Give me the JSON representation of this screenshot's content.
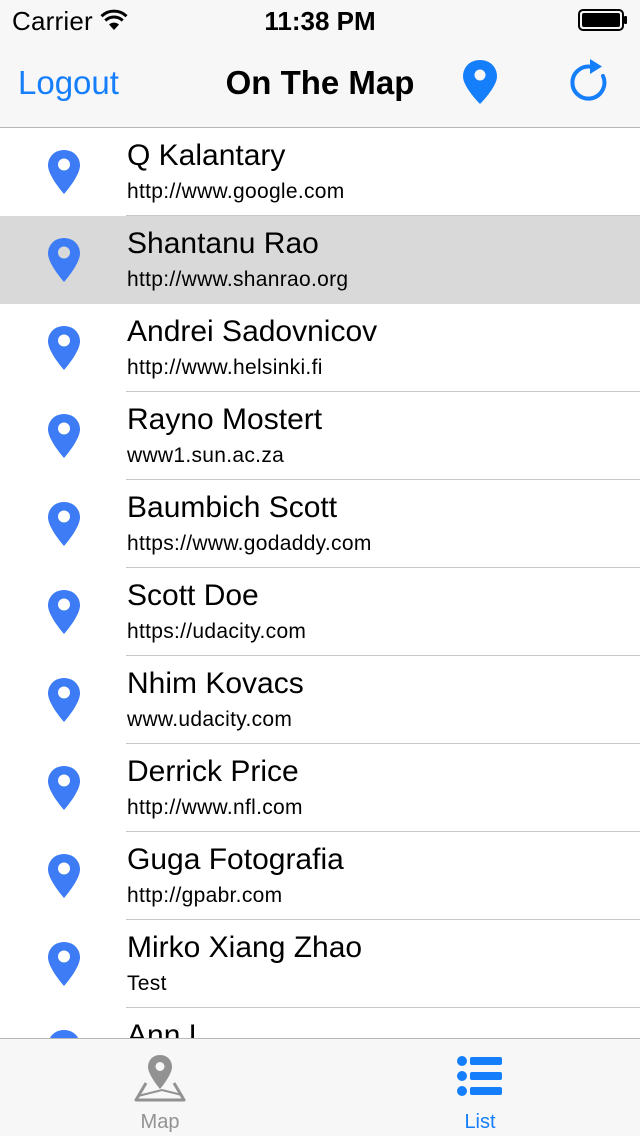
{
  "status_bar": {
    "carrier": "Carrier",
    "time": "11:38 PM",
    "icons": [
      "wifi-icon",
      "battery-icon"
    ]
  },
  "nav": {
    "left_button": "Logout",
    "title": "On The Map",
    "right_icons": [
      "pin-icon",
      "refresh-icon"
    ]
  },
  "colors": {
    "accent": "#157efb",
    "pin": "#3d7cf5",
    "selected_row": "#d9d9d9",
    "inactive_tab": "#929292"
  },
  "list": {
    "row_icon": "pin-icon",
    "selected_index": 1,
    "rows": [
      {
        "name": "Q Kalantary",
        "url": "http://www.google.com"
      },
      {
        "name": "Shantanu Rao",
        "url": "http://www.shanrao.org"
      },
      {
        "name": "Andrei Sadovnicov",
        "url": "http://www.helsinki.fi"
      },
      {
        "name": "Rayno Mostert",
        "url": "www1.sun.ac.za"
      },
      {
        "name": "Baumbich Scott",
        "url": "https://www.godaddy.com"
      },
      {
        "name": "Scott Doe",
        "url": "https://udacity.com"
      },
      {
        "name": "Nhim Kovacs",
        "url": "www.udacity.com"
      },
      {
        "name": "Derrick Price",
        "url": "http://www.nfl.com"
      },
      {
        "name": "Guga Fotografia",
        "url": "http://gpabr.com"
      },
      {
        "name": "Mirko Xiang Zhao",
        "url": "Test"
      },
      {
        "name": "Ann L",
        "url": ""
      }
    ]
  },
  "tabs": [
    {
      "label": "Map",
      "icon": "map-icon",
      "active": false
    },
    {
      "label": "List",
      "icon": "list-icon",
      "active": true
    }
  ]
}
